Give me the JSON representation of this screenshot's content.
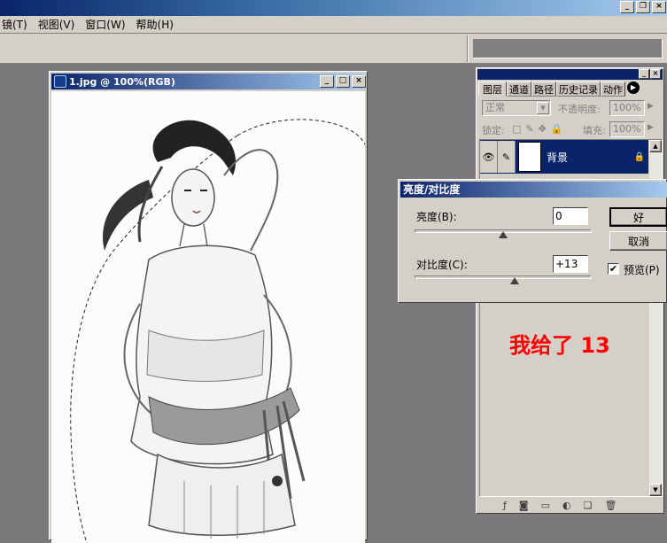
{
  "menubar": {
    "items": [
      "镜(T)",
      "视图(V)",
      "窗口(W)",
      "帮助(H)"
    ]
  },
  "window_controls": {
    "minimize": "_",
    "restore": "❐",
    "close": "×"
  },
  "doc_window": {
    "title": "1.jpg @ 100%(RGB)"
  },
  "layers_panel": {
    "tabs": [
      "图层",
      "通道",
      "路径",
      "历史记录",
      "动作"
    ],
    "blend_mode": "正常",
    "opacity_label": "不透明度:",
    "opacity_value": "100%",
    "lock_label": "锁定:",
    "fill_label": "填充:",
    "fill_value": "100%",
    "layer_name": "背景",
    "note": "我给了 13"
  },
  "dialog": {
    "title": "亮度/对比度",
    "brightness_label": "亮度(B):",
    "brightness_value": "0",
    "brightness_slider": 0.5,
    "contrast_label": "对比度(C):",
    "contrast_value": "+13",
    "contrast_slider": 0.565,
    "ok_label": "好",
    "cancel_label": "取消",
    "preview_label": "预览(P)",
    "preview_checked": true
  }
}
